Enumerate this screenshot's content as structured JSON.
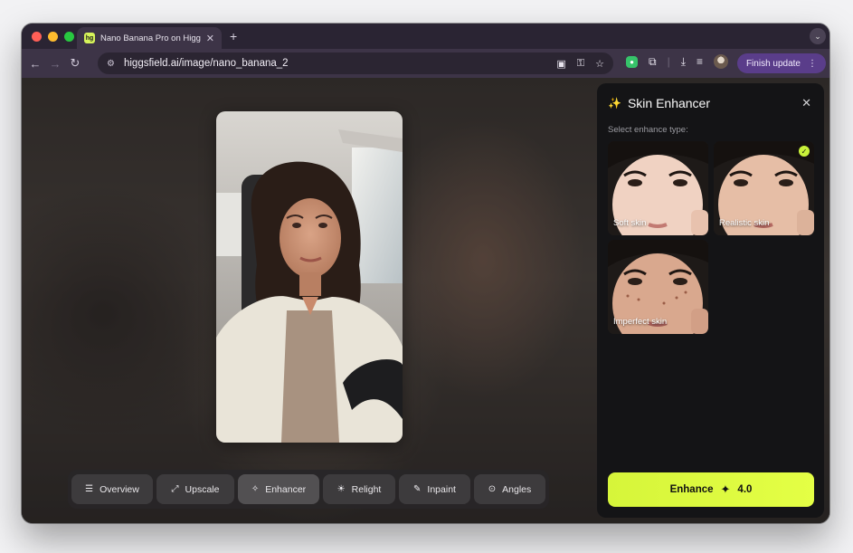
{
  "browser": {
    "tab_title": "Nano Banana Pro on Higgsfield",
    "favicon_text": "hg",
    "url": "higgsfield.ai/image/nano_banana_2",
    "finish_update_label": "Finish update",
    "traffic_colors": [
      "#ff5f57",
      "#febc2e",
      "#28c840"
    ]
  },
  "toolbar": {
    "tools": [
      {
        "label": "Overview",
        "icon": "list-icon"
      },
      {
        "label": "Upscale",
        "icon": "expand-icon"
      },
      {
        "label": "Enhancer",
        "icon": "wand-icon"
      },
      {
        "label": "Relight",
        "icon": "light-icon"
      },
      {
        "label": "Inpaint",
        "icon": "brush-icon"
      },
      {
        "label": "Angles",
        "icon": "camera-icon"
      }
    ],
    "active_tool": "Enhancer"
  },
  "panel": {
    "title": "Skin Enhancer",
    "subtitle": "Select enhance type:",
    "options": [
      {
        "label": "Soft skin",
        "selected": false
      },
      {
        "label": "Realistic skin",
        "selected": true
      },
      {
        "label": "Imperfect skin",
        "selected": false
      }
    ],
    "enhance_label": "Enhance",
    "enhance_cost": "4.0",
    "accent": "#d6f53a"
  }
}
